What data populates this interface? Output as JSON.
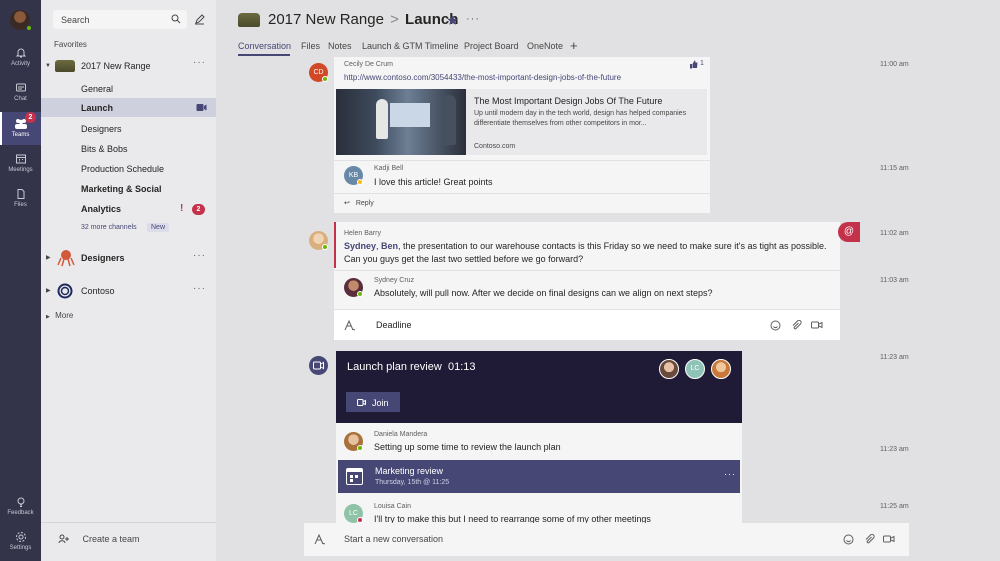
{
  "rail": {
    "items": [
      {
        "label": "Activity"
      },
      {
        "label": "Chat"
      },
      {
        "label": "Teams",
        "badge": "2"
      },
      {
        "label": "Meetings"
      },
      {
        "label": "Files"
      }
    ],
    "bottom": [
      {
        "label": "Feedback"
      },
      {
        "label": "Settings"
      }
    ]
  },
  "panel": {
    "search_placeholder": "Search",
    "favorites_label": "Favorites",
    "team1": {
      "name": "2017 New Range",
      "channels": [
        {
          "label": "General"
        },
        {
          "label": "Launch"
        },
        {
          "label": "Designers"
        },
        {
          "label": "Bits & Bobs"
        },
        {
          "label": "Production Schedule"
        },
        {
          "label": "Marketing & Social"
        },
        {
          "label": "Analytics",
          "badge": "2"
        }
      ],
      "more_channels": "32 more channels",
      "new_label": "New"
    },
    "team2": {
      "name": "Designers"
    },
    "team3": {
      "name": "Contoso"
    },
    "more_label": "More",
    "create_team": "Create a team"
  },
  "header": {
    "team": "2017 New Range",
    "separator": ">",
    "channel": "Launch",
    "tabs": [
      "Conversation",
      "Files",
      "Notes",
      "Launch & GTM Timeline",
      "Project Board",
      "OneNote"
    ]
  },
  "thread1": {
    "author": "Cecily De Crum",
    "initials": "CD",
    "link": "http://www.contoso.com/3054433/the-most-important-design-jobs-of-the-future",
    "likes": "1",
    "time": "11:00 am",
    "preview": {
      "title": "The Most Important Design Jobs Of The Future",
      "desc": "Up until modern day in the tech world, design has helped companies differentiate themselves from other competitors in mor...",
      "domain": "Contoso.com"
    },
    "reply": {
      "author": "Kadji Bell",
      "initials": "KB",
      "text": "I love this article! Great points",
      "time": "11:15 am"
    },
    "reply_label": "Reply"
  },
  "thread2": {
    "author": "Helen Barry",
    "mention1": "Sydney",
    "sep": ", ",
    "mention2": "Ben",
    "text": ", the presentation to our warehouse contacts is this Friday so we need to make sure it's as tight as possible. Can you guys get the last two settled before we go forward?",
    "time": "11:02 am",
    "reply": {
      "author": "Sydney Cruz",
      "text": "Absolutely, will pull now. After we decide on final designs can we align on next steps?",
      "time": "11:03 am"
    },
    "compose_text": "Deadline"
  },
  "meeting": {
    "title": "Launch plan review",
    "duration": "01:13",
    "join_label": "Join",
    "participant_initials": "LC",
    "time": "11:23 am",
    "reply1": {
      "author": "Daniela Mandera",
      "text": "Setting up some time to review the launch plan",
      "time": "11:23 am"
    },
    "event": {
      "title": "Marketing review",
      "date": "Thursday, 15th @ 11:25"
    },
    "reply2": {
      "author": "Louisa Cain",
      "initials": "LC",
      "text": "I'll try to make this but I need to rearrange some of my other meetings",
      "time": "11:25 am"
    }
  },
  "compose": {
    "placeholder": "Start a new conversation"
  },
  "colors": {
    "brand": "#464775",
    "rail": "#33344a",
    "mention": "#c4314b",
    "meeting_bg": "#1f1a36",
    "event_bg": "#464775"
  }
}
